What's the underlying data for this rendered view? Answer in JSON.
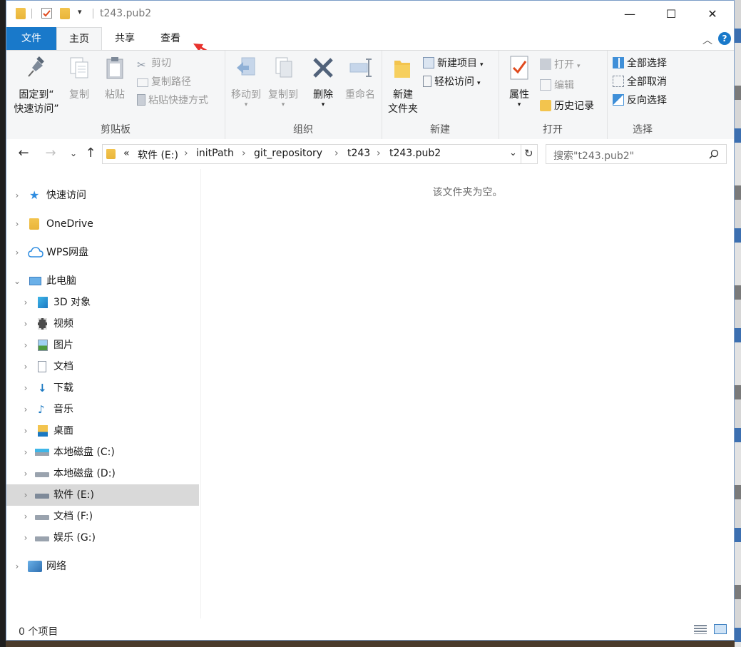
{
  "window": {
    "title": "t243.pub2",
    "controls": {
      "minimize": "—",
      "maximize": "☐",
      "close": "✕"
    }
  },
  "ribbon_tabs": {
    "file": "文件",
    "home": "主页",
    "share": "共享",
    "view": "查看"
  },
  "ribbon": {
    "clipboard": {
      "label": "剪贴板",
      "pin_line1": "固定到“",
      "pin_line2": "快速访问”",
      "copy": "复制",
      "paste": "粘贴",
      "cut": "剪切",
      "copy_path": "复制路径",
      "paste_shortcut": "粘贴快捷方式"
    },
    "organize": {
      "label": "组织",
      "move_to": "移动到",
      "copy_to": "复制到",
      "delete": "删除",
      "rename": "重命名"
    },
    "new": {
      "label": "新建",
      "new_folder_line1": "新建",
      "new_folder_line2": "文件夹",
      "new_item": "新建项目",
      "easy_access": "轻松访问"
    },
    "open": {
      "label": "打开",
      "properties": "属性",
      "open": "打开",
      "edit": "编辑",
      "history": "历史记录"
    },
    "select": {
      "label": "选择",
      "select_all": "全部选择",
      "select_none": "全部取消",
      "invert": "反向选择"
    }
  },
  "address": {
    "overflow": "«",
    "crumbs": [
      "软件 (E:)",
      "initPath",
      "git_repository",
      "t243",
      "t243.pub2"
    ]
  },
  "search": {
    "placeholder": "搜索\"t243.pub2\""
  },
  "nav": {
    "quick_access": "快速访问",
    "onedrive": "OneDrive",
    "wps": "WPS网盘",
    "this_pc": "此电脑",
    "objects3d": "3D 对象",
    "videos": "视频",
    "pictures": "图片",
    "documents": "文档",
    "downloads": "下载",
    "music": "音乐",
    "desktop": "桌面",
    "drive_c": "本地磁盘 (C:)",
    "drive_d": "本地磁盘 (D:)",
    "drive_e": "软件 (E:)",
    "drive_f": "文档 (F:)",
    "drive_g": "娱乐 (G:)",
    "network": "网络"
  },
  "content": {
    "empty_message": "该文件夹为空。"
  },
  "status": {
    "item_count": "0 个项目"
  },
  "colors": {
    "accent": "#1979ca",
    "annotation_arrow": "#e8322d",
    "selected": "#d9d9d9"
  }
}
